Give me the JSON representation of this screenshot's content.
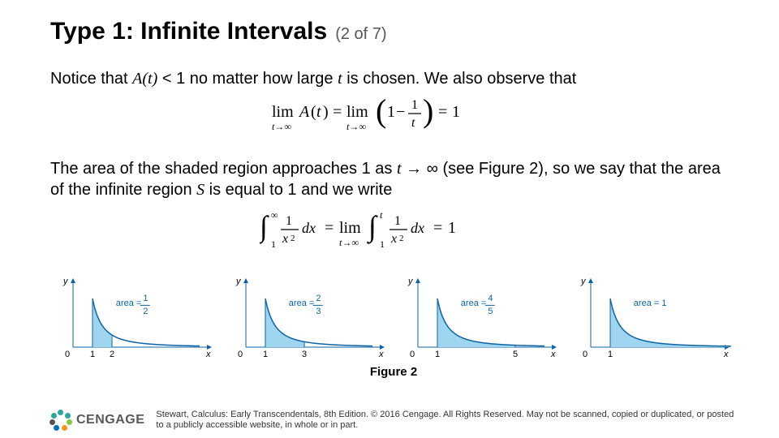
{
  "header": {
    "title": "Type 1: Infinite Intervals",
    "pager": "(2 of 7)"
  },
  "body": {
    "p1_a": "Notice that ",
    "p1_At": "A",
    "p1_paren_t": "(t)",
    "p1_b": " < 1 no matter how large ",
    "p1_t": "t",
    "p1_c": " is chosen. We also observe that",
    "p2_a": "The area of the shaded region approaches 1 as ",
    "p2_t": "t",
    "p2_b": " → ∞ (see Figure 2), so we say that the area of the infinite region ",
    "p2_S": "S",
    "p2_c": " is equal to 1 and we write"
  },
  "figure": {
    "caption": "Figure 2",
    "panels": [
      {
        "t": 2,
        "area_tex": "area = 1/2"
      },
      {
        "t": 3,
        "area_tex": "area = 2/3"
      },
      {
        "t": 5,
        "area_tex": "area = 4/5"
      },
      {
        "t": null,
        "area_tex": "area = 1"
      }
    ]
  },
  "equations": {
    "eq1_plain": "lim_{t→∞} A(t) = lim_{t→∞} (1 − 1/t) = 1",
    "eq2_plain": "∫_1^∞ (1/x^2) dx = lim_{t→∞} ∫_1^t (1/x^2) dx = 1"
  },
  "footer": {
    "brand": "CENGAGE",
    "copyright": "Stewart, Calculus: Early Transcendentals, 8th Edition. © 2016 Cengage. All Rights Reserved. May not be scanned, copied or duplicated, or posted to a publicly accessible website, in whole or in part."
  },
  "chart_data": [
    {
      "type": "area",
      "title": "area = 1/2",
      "xlabel": "x",
      "ylabel": "y",
      "xlim": [
        0,
        6
      ],
      "ylim": [
        0,
        1.2
      ],
      "series": [
        {
          "name": "y=1/x^2",
          "x": [
            1,
            1.5,
            2,
            3,
            4,
            5,
            6
          ],
          "y": [
            1,
            0.444,
            0.25,
            0.111,
            0.0625,
            0.04,
            0.0278
          ]
        }
      ],
      "shaded_x": [
        1,
        2
      ],
      "annotations": [
        "t=2",
        "area=1/2"
      ]
    },
    {
      "type": "area",
      "title": "area = 2/3",
      "xlabel": "x",
      "ylabel": "y",
      "xlim": [
        0,
        6
      ],
      "ylim": [
        0,
        1.2
      ],
      "series": [
        {
          "name": "y=1/x^2",
          "x": [
            1,
            1.5,
            2,
            3,
            4,
            5,
            6
          ],
          "y": [
            1,
            0.444,
            0.25,
            0.111,
            0.0625,
            0.04,
            0.0278
          ]
        }
      ],
      "shaded_x": [
        1,
        3
      ],
      "annotations": [
        "t=3",
        "area=2/3"
      ]
    },
    {
      "type": "area",
      "title": "area = 4/5",
      "xlabel": "x",
      "ylabel": "y",
      "xlim": [
        0,
        6
      ],
      "ylim": [
        0,
        1.2
      ],
      "series": [
        {
          "name": "y=1/x^2",
          "x": [
            1,
            1.5,
            2,
            3,
            4,
            5,
            6
          ],
          "y": [
            1,
            0.444,
            0.25,
            0.111,
            0.0625,
            0.04,
            0.0278
          ]
        }
      ],
      "shaded_x": [
        1,
        5
      ],
      "annotations": [
        "t=5",
        "area=4/5"
      ]
    },
    {
      "type": "area",
      "title": "area = 1",
      "xlabel": "x",
      "ylabel": "y",
      "xlim": [
        0,
        8
      ],
      "ylim": [
        0,
        1.2
      ],
      "series": [
        {
          "name": "y=1/x^2",
          "x": [
            1,
            1.5,
            2,
            3,
            4,
            5,
            6,
            7,
            8
          ],
          "y": [
            1,
            0.444,
            0.25,
            0.111,
            0.0625,
            0.04,
            0.0278,
            0.0204,
            0.0156
          ]
        }
      ],
      "shaded_x": [
        1,
        8
      ],
      "annotations": [
        "t→∞",
        "area=1"
      ]
    }
  ]
}
